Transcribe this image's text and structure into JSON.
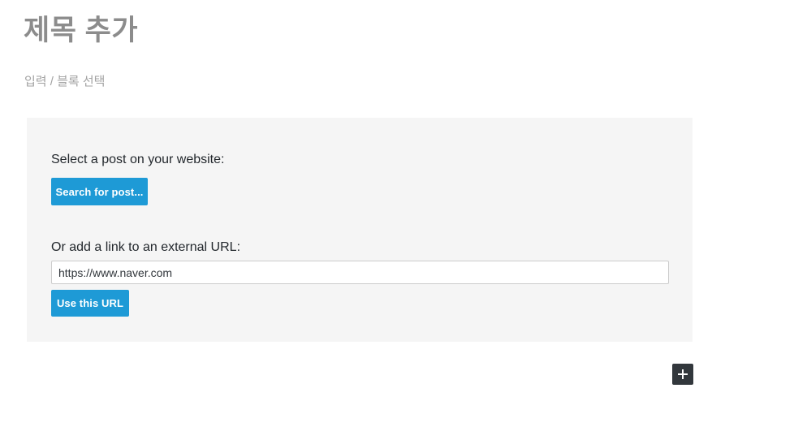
{
  "header": {
    "title": "제목 추가",
    "breadcrumb": "입력 / 블록 선택"
  },
  "link_panel": {
    "select_post_label": "Select a post on your website:",
    "search_post_button": "Search for post...",
    "external_url_label": "Or add a link to an external URL:",
    "url_input_value": "https://www.naver.com",
    "url_input_placeholder": "https://",
    "use_url_button": "Use this URL"
  },
  "footer": {
    "add_block_icon": "plus-icon"
  },
  "colors": {
    "accent_blue": "#1e9ad6",
    "panel_background": "#f5f5f5",
    "title_gray": "#8c8c8c",
    "breadcrumb_gray": "#a2a2a2",
    "dark_button": "#32373c",
    "text_dark": "#23282d",
    "input_border": "#cccccc"
  }
}
